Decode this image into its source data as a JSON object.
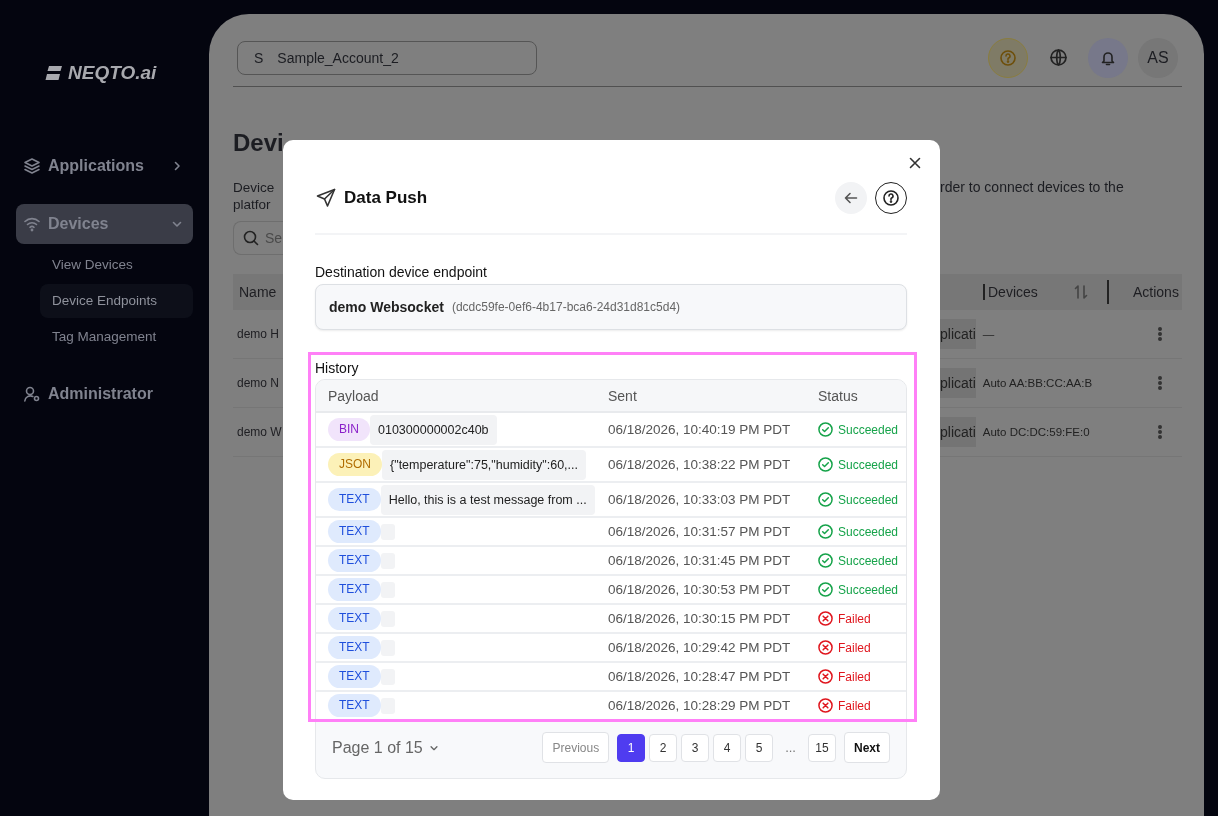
{
  "sidebar": {
    "logo": "NEQTO.ai",
    "items": [
      {
        "label": "Applications",
        "kind": "group",
        "expanded": false,
        "selected": false
      },
      {
        "label": "Devices",
        "kind": "group",
        "expanded": true,
        "selected": true,
        "children": [
          {
            "label": "View Devices",
            "selected": false
          },
          {
            "label": "Device Endpoints",
            "selected": true
          },
          {
            "label": "Tag Management",
            "selected": false
          }
        ]
      },
      {
        "label": "Administrator",
        "kind": "link",
        "selected": false
      }
    ]
  },
  "header": {
    "account": {
      "initial": "S",
      "name": "Sample_Account_2"
    },
    "avatar": "AS"
  },
  "page": {
    "title": "Devi",
    "description_left": [
      "Device",
      "platfor"
    ],
    "description_right": "rder to connect devices to the",
    "search": {
      "placeholder": "Se"
    },
    "table": {
      "columns": [
        "Name",
        "Devices",
        "Actions"
      ],
      "rows": [
        {
          "name": "demo H",
          "application": "plicati",
          "devices": "—"
        },
        {
          "name": "demo N",
          "application": "plicati",
          "devices": "Auto AA:BB:CC:AA:B"
        },
        {
          "name": "demo W",
          "application": "plicati",
          "devices": "Auto DC:DC:59:FE:0"
        }
      ]
    }
  },
  "modal": {
    "title": "Data Push",
    "destination": {
      "label": "Destination device endpoint",
      "name": "demo Websocket",
      "id": "(dcdc59fe-0ef6-4b17-bca6-24d31d81c5d4)"
    },
    "history": {
      "label": "History",
      "highlighted": true,
      "columns": [
        "Payload",
        "Sent",
        "Status"
      ],
      "rows": [
        {
          "tag": {
            "label": "BIN",
            "kind": "bin"
          },
          "payload": "010300000002c40b",
          "sent": "06/18/2026, 10:40:19 PM PDT",
          "status": {
            "text": "Succeeded",
            "kind": "success"
          }
        },
        {
          "tag": {
            "label": "JSON",
            "kind": "json"
          },
          "payload": "{\"temperature\":75,\"humidity\":60,...",
          "sent": "06/18/2026, 10:38:22 PM PDT",
          "status": {
            "text": "Succeeded",
            "kind": "success"
          }
        },
        {
          "tag": {
            "label": "TEXT",
            "kind": "text"
          },
          "payload": "Hello, this is a test message from ...",
          "sent": "06/18/2026, 10:33:03 PM PDT",
          "status": {
            "text": "Succeeded",
            "kind": "success"
          }
        },
        {
          "tag": {
            "label": "TEXT",
            "kind": "text"
          },
          "sent": "06/18/2026, 10:31:57 PM PDT",
          "status": {
            "text": "Succeeded",
            "kind": "success"
          }
        },
        {
          "tag": {
            "label": "TEXT",
            "kind": "text"
          },
          "sent": "06/18/2026, 10:31:45 PM PDT",
          "status": {
            "text": "Succeeded",
            "kind": "success"
          }
        },
        {
          "tag": {
            "label": "TEXT",
            "kind": "text"
          },
          "sent": "06/18/2026, 10:30:53 PM PDT",
          "status": {
            "text": "Succeeded",
            "kind": "success"
          }
        },
        {
          "tag": {
            "label": "TEXT",
            "kind": "text"
          },
          "sent": "06/18/2026, 10:30:15 PM PDT",
          "status": {
            "text": "Failed",
            "kind": "failed"
          }
        },
        {
          "tag": {
            "label": "TEXT",
            "kind": "text"
          },
          "sent": "06/18/2026, 10:29:42 PM PDT",
          "status": {
            "text": "Failed",
            "kind": "failed"
          }
        },
        {
          "tag": {
            "label": "TEXT",
            "kind": "text"
          },
          "sent": "06/18/2026, 10:28:47 PM PDT",
          "status": {
            "text": "Failed",
            "kind": "failed"
          }
        },
        {
          "tag": {
            "label": "TEXT",
            "kind": "text"
          },
          "sent": "06/18/2026, 10:28:29 PM PDT",
          "status": {
            "text": "Failed",
            "kind": "failed"
          }
        }
      ]
    },
    "pagination": {
      "page_label": "Page 1 of 15",
      "previous": "Previous",
      "next": "Next",
      "pages": [
        {
          "label": "1",
          "kind": "page",
          "selected": true
        },
        {
          "label": "2",
          "kind": "page",
          "selected": false
        },
        {
          "label": "3",
          "kind": "page",
          "selected": false
        },
        {
          "label": "4",
          "kind": "page",
          "selected": false
        },
        {
          "label": "5",
          "kind": "page",
          "selected": false
        },
        {
          "label": "...",
          "kind": "ellipsis"
        },
        {
          "label": "15",
          "kind": "page",
          "selected": false
        }
      ]
    }
  }
}
